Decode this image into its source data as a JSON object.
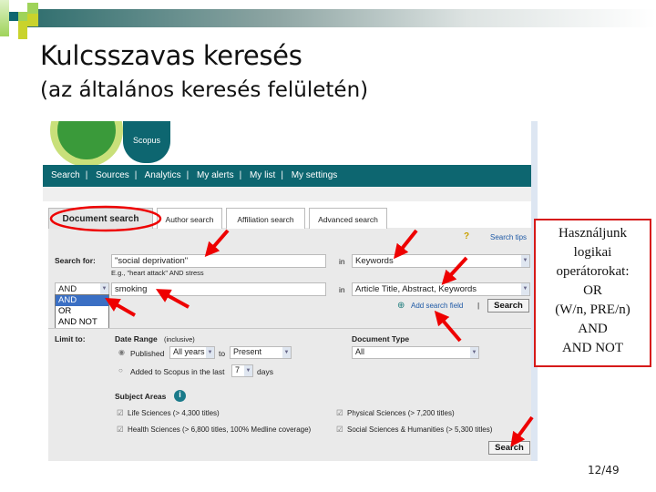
{
  "slide": {
    "title": "Kulcsszavas keresés",
    "subtitle": "(az általános keresés felületén)",
    "page": "12/49"
  },
  "callout": {
    "lines": [
      "Használjunk",
      "logikai",
      "operátorokat:",
      "OR",
      "(W/n, PRE/n)",
      "AND",
      "AND NOT"
    ]
  },
  "scopus": {
    "logo": "Scopus",
    "nav": [
      "Search",
      "Sources",
      "Analytics",
      "My alerts",
      "My list",
      "My settings"
    ],
    "tabs": [
      "Document search",
      "Author search",
      "Affiliation search",
      "Advanced search"
    ],
    "search_tips": "Search tips",
    "search_for_label": "Search for:",
    "query1": "\"social deprivation\"",
    "hint": "E.g., \"heart attack\" AND stress",
    "in_label": "in",
    "field1": "Keywords",
    "operator": "AND",
    "operator_options": [
      "AND",
      "OR",
      "AND NOT"
    ],
    "query2": "smoking",
    "field2": "Article Title, Abstract, Keywords",
    "add_field": "Add search field",
    "search_button": "Search",
    "limit_to": "Limit to:",
    "date_range": "Date Range",
    "inclusive": "(inclusive)",
    "published": "Published",
    "from_year": "All years",
    "to": "to",
    "to_year": "Present",
    "added_label": "Added to Scopus in the last",
    "days_value": "7",
    "days": "days",
    "doc_type_label": "Document Type",
    "doc_type": "All",
    "subject_areas": "Subject Areas",
    "areas": [
      "Life Sciences (> 4,300 titles)",
      "Physical Sciences (> 7,200 titles)",
      "Health Sciences (> 6,800 titles, 100% Medline coverage)",
      "Social Sciences & Humanities (> 5,300 titles)"
    ]
  },
  "colors": {
    "nav": "#0d6670",
    "accent_red": "#d61a1a",
    "logo_green": "#3a9a3a"
  }
}
